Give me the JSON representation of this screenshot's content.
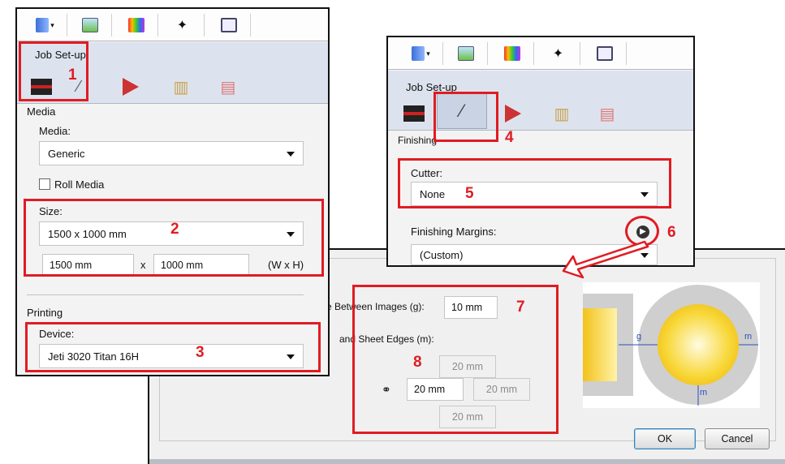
{
  "left_panel": {
    "job_setup": "Job Set-up",
    "media_section": "Media",
    "media_label": "Media:",
    "media_value": "Generic",
    "roll_media": "Roll Media",
    "size_label": "Size:",
    "size_value": "1500 x 1000 mm",
    "width": "1500 mm",
    "times": "x",
    "height": "1000 mm",
    "wxh": "(W x H)",
    "printing_section": "Printing",
    "device_label": "Device:",
    "device_value": "Jeti 3020 Titan 16H"
  },
  "right_panel": {
    "job_setup": "Job Set-up",
    "finishing_section": "Finishing",
    "cutter_label": "Cutter:",
    "cutter_value": "None",
    "margins_label": "Finishing Margins:",
    "margins_value": "(Custom)"
  },
  "dialog": {
    "between_label": "e Between Images (g):",
    "between_value": "10 mm",
    "edges_label": "and Sheet Edges (m):",
    "top": "20 mm",
    "left": "20 mm",
    "right": "20 mm",
    "bottom": "20 mm",
    "diagram_g": "g",
    "diagram_m1": "m",
    "diagram_m2": "m",
    "ok": "OK",
    "cancel": "Cancel"
  },
  "annotations": {
    "n1": "1",
    "n2": "2",
    "n3": "3",
    "n4": "4",
    "n5": "5",
    "n6": "6",
    "n7": "7",
    "n8": "8"
  },
  "colors": {
    "annotation_red": "#e11b22",
    "band_blue": "#dde3ee",
    "diagram_yellow": "#f8d83a"
  }
}
